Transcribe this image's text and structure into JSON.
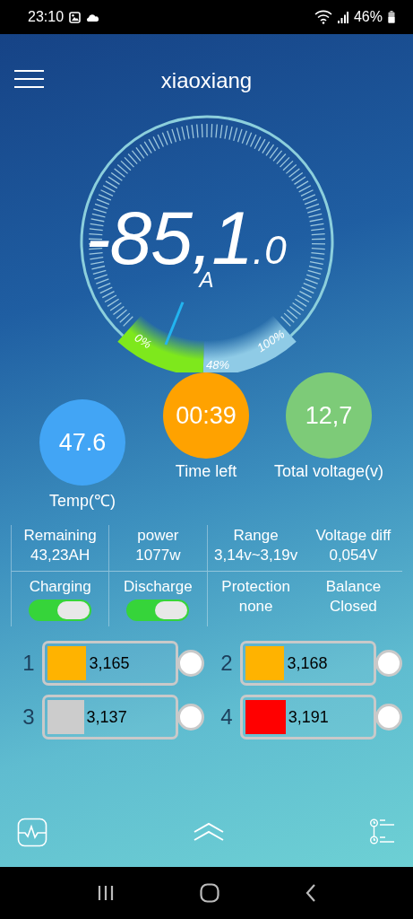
{
  "status_bar": {
    "time": "23:10",
    "battery": "46%"
  },
  "header": {
    "title": "xiaoxiang"
  },
  "gauge": {
    "current": "-85,1",
    "decimal": ".0",
    "unit": "A",
    "scale_labels": [
      "0%",
      "48%",
      "100%"
    ]
  },
  "metrics": [
    {
      "value": "47.6",
      "label": "Temp(℃)",
      "color": "#42a5f5"
    },
    {
      "value": "00:39",
      "label": "Time left",
      "color": "#ffa200"
    },
    {
      "value": "12,7",
      "label": "Total voltage(v)",
      "color": "#7dcb78"
    }
  ],
  "stats": [
    {
      "label": "Remaining",
      "value": "43,23AH"
    },
    {
      "label": "power",
      "value": "1077w"
    },
    {
      "label": "Range",
      "value": "3,14v~3,19v"
    },
    {
      "label": "Voltage diff",
      "value": "0,054V"
    }
  ],
  "controls": [
    {
      "label": "Charging",
      "kind": "toggle",
      "on": true
    },
    {
      "label": "Discharge",
      "kind": "toggle",
      "on": true
    },
    {
      "label": "Protection",
      "kind": "text",
      "value": "none"
    },
    {
      "label": "Balance",
      "kind": "text",
      "value": "Closed"
    }
  ],
  "cells": [
    {
      "index": "1",
      "value": "3,165",
      "color": "#ffb300",
      "level": 0.31
    },
    {
      "index": "2",
      "value": "3,168",
      "color": "#ffb300",
      "level": 0.31
    },
    {
      "index": "3",
      "value": "3,137",
      "color": "#cccccc",
      "level": 0.29
    },
    {
      "index": "4",
      "value": "3,191",
      "color": "#ff0000",
      "level": 0.32
    }
  ]
}
